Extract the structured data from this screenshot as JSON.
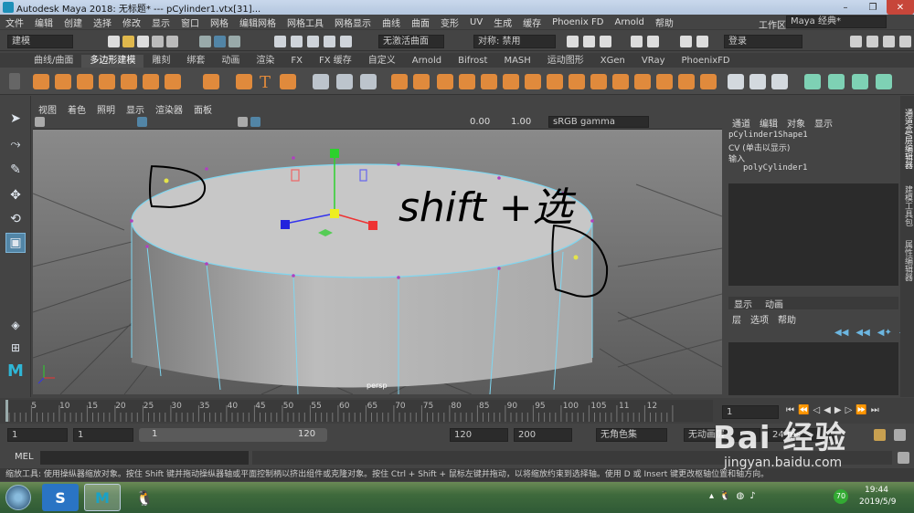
{
  "window": {
    "title": "Autodesk Maya 2018: 无标题*   ---   pCylinder1.vtx[31]...",
    "minimize": "–",
    "maximize": "❐",
    "close": "✕"
  },
  "menubar": [
    "文件",
    "编辑",
    "创建",
    "选择",
    "修改",
    "显示",
    "窗口",
    "网格",
    "编辑网格",
    "网格工具",
    "网格显示",
    "曲线",
    "曲面",
    "变形",
    "UV",
    "生成",
    "缓存",
    "Phoenix FD",
    "Arnold",
    "帮助"
  ],
  "workspace": {
    "label": "工作区:",
    "value": "Maya 经典*"
  },
  "statusline": {
    "mode": "建模",
    "snap_field": "无激活曲面",
    "symmetry": "对称: 禁用",
    "login": "登录"
  },
  "shelf_tabs": [
    "曲线/曲面",
    "多边形建模",
    "雕刻",
    "绑套",
    "动画",
    "渲染",
    "FX",
    "FX 缓存",
    "自定义",
    "Arnold",
    "Bifrost",
    "MASH",
    "运动图形",
    "XGen",
    "VRay",
    "PhoenixFD"
  ],
  "shelf_active": "多边形建模",
  "viewport": {
    "menu": [
      "视图",
      "着色",
      "照明",
      "显示",
      "渲染器",
      "面板"
    ],
    "exposure": "0.00",
    "gamma": "1.00",
    "colorspace": "sRGB gamma",
    "camera_label": "persp",
    "annotation_text": "shift +选"
  },
  "channel_box": {
    "tabs": [
      "通道",
      "编辑",
      "对象",
      "显示"
    ],
    "shape": "pCylinder1Shape1",
    "cv_line": "CV (单击以显示)",
    "inputs_label": "输入",
    "input_node": "polyCylinder1"
  },
  "layer_editor": {
    "tabs": [
      "显示",
      "动画"
    ],
    "menu": [
      "层",
      "选项",
      "帮助"
    ]
  },
  "side_tabs": [
    "通道盒/层编辑器",
    "建模工具包",
    "属性编辑器"
  ],
  "timeline": {
    "ticks": [
      "5",
      "10",
      "15",
      "20",
      "25",
      "30",
      "35",
      "40",
      "45",
      "50",
      "55",
      "60",
      "65",
      "70",
      "75",
      "80",
      "85",
      "90",
      "95",
      "100",
      "105",
      "11",
      "12"
    ],
    "current_frame": "1"
  },
  "range": {
    "start": "1",
    "playback_start": "1",
    "slider_start": "1",
    "slider_end": "120",
    "playback_end": "120",
    "end": "200",
    "char_set": "无角色集",
    "anim_layer": "无动画层",
    "fps": "24 fps"
  },
  "cmdline": {
    "label": "MEL"
  },
  "helpline": "缩放工具: 使用操纵器缩放对象。按住 Shift 键并拖动操纵器轴或平面控制柄以挤出组件或克隆对象。按住 Ctrl + Shift + 鼠标左键并拖动，以将缩放约束到选择轴。使用 D 或 Insert 键更改枢轴位置和轴方向。",
  "taskbar": {
    "time": "19:44",
    "date": "2019/5/9",
    "badge": "70"
  },
  "watermark": {
    "text": "Bai 经验",
    "url": "jingyan.baidu.com"
  },
  "colors": {
    "accent": "#5285a6",
    "wire": "#7fd6f0",
    "active_vertex": "#e4e44a"
  }
}
